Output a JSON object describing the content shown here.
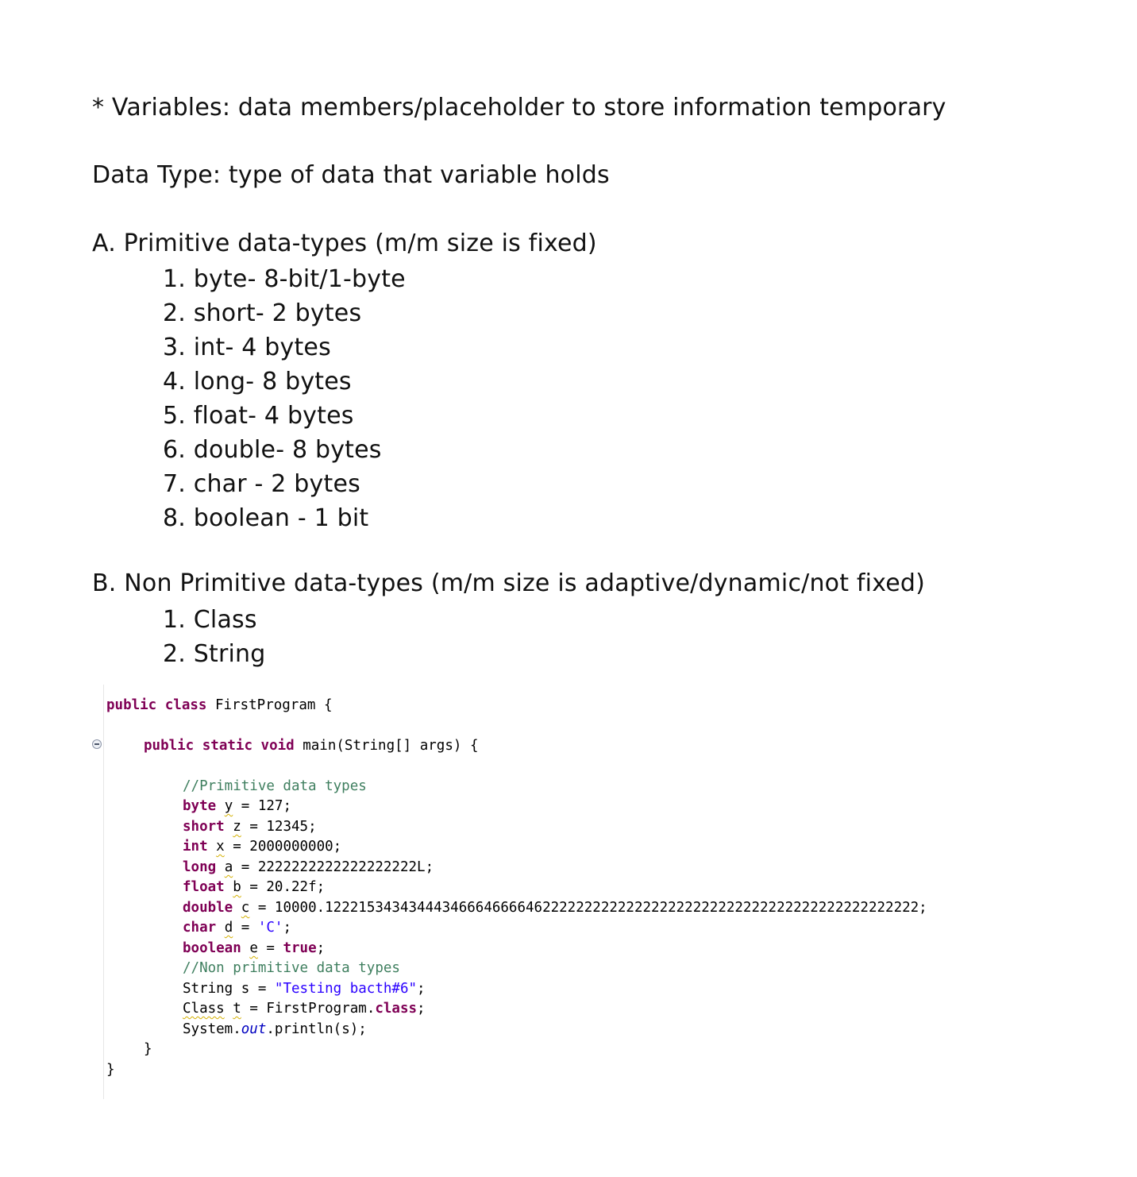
{
  "notes": {
    "variables_line": "* Variables: data members/placeholder  to store information temporary",
    "data_type_line": "Data Type: type of data that variable holds",
    "primitive_heading": "A. Primitive data-types (m/m size is fixed)",
    "primitive_items": [
      "1. byte- 8-bit/1-byte",
      "2. short- 2 bytes",
      "3. int- 4 bytes",
      "4. long- 8 bytes",
      "5. float- 4 bytes",
      "6. double- 8 bytes",
      "7. char - 2 bytes",
      "8. boolean - 1 bit"
    ],
    "nonprimitive_heading": "B. Non Primitive data-types (m/m size is adaptive/dynamic/not fixed)",
    "nonprimitive_items": [
      "1. Class",
      "2. String"
    ]
  },
  "code": {
    "class_kw1": "public",
    "class_kw2": "class",
    "class_name": " FirstProgram {",
    "main_kw1": "public",
    "main_kw2": "static",
    "main_kw3": "void",
    "main_sig": " main(String[] args) {",
    "comment_primitive": "//Primitive data types",
    "byte_kw": "byte",
    "byte_var": "y",
    "byte_val": " = 127;",
    "short_kw": "short",
    "short_var": "z",
    "short_val": " = 12345;",
    "int_kw": "int",
    "int_var": "x",
    "int_val": " = 2000000000;",
    "long_kw": "long",
    "long_var": "a",
    "long_val": " = 2222222222222222222L;",
    "float_kw": "float",
    "float_var": "b",
    "float_val": " = 20.22f;",
    "double_kw": "double",
    "double_var": "c",
    "double_val": " = 10000.12221534343444346664666646222222222222222222222222222222222222222222222;",
    "char_kw": "char",
    "char_var": "d",
    "char_eq": " = ",
    "char_lit": "'C'",
    "char_end": ";",
    "boolean_kw": "boolean",
    "boolean_var": "e",
    "boolean_eq": " = ",
    "boolean_lit": "true",
    "boolean_end": ";",
    "comment_nonprimitive": "//Non primitive data types",
    "string_type": "String s = ",
    "string_lit": "\"Testing bacth#6\"",
    "string_end": ";",
    "class_type": "Class",
    "class_var": "t",
    "class_eq": " = FirstProgram.",
    "class_kw": "class",
    "class_end": ";",
    "sysout_pre": "System.",
    "sysout_field": "out",
    "sysout_post": ".println(s);",
    "close_inner": "}",
    "close_outer": "}"
  }
}
